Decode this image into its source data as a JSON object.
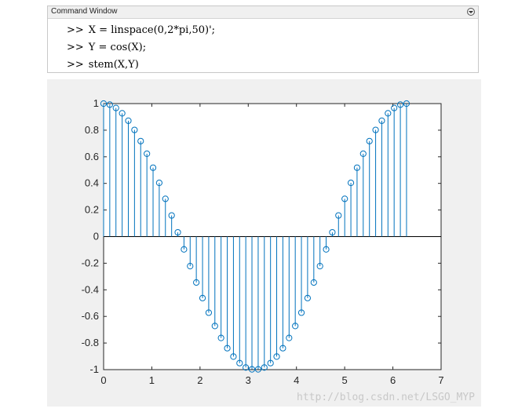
{
  "command_window": {
    "title": "Command Window",
    "prompt": ">>",
    "lines": [
      "X = linspace(0,2*pi,50)';",
      "Y = cos(X);",
      "stem(X,Y)"
    ]
  },
  "colors": {
    "stem": "#0072BD",
    "axes_background": "#ffffff",
    "figure_background": "#f0f0f0"
  },
  "chart_data": {
    "type": "stem",
    "title": "",
    "xlabel": "",
    "ylabel": "",
    "xlim": [
      0,
      7
    ],
    "ylim": [
      -1,
      1
    ],
    "xticks": [
      "0",
      "1",
      "2",
      "3",
      "4",
      "5",
      "6",
      "7"
    ],
    "yticks": [
      "-1",
      "-0.8",
      "-0.6",
      "-0.4",
      "-0.2",
      "0",
      "0.2",
      "0.4",
      "0.6",
      "0.8",
      "1"
    ],
    "grid": false,
    "x": [
      0,
      0.128,
      0.256,
      0.385,
      0.513,
      0.641,
      0.769,
      0.898,
      1.026,
      1.154,
      1.282,
      1.411,
      1.539,
      1.667,
      1.795,
      1.923,
      2.052,
      2.18,
      2.308,
      2.436,
      2.565,
      2.693,
      2.821,
      2.949,
      3.077,
      3.206,
      3.334,
      3.462,
      3.59,
      3.718,
      3.847,
      3.975,
      4.103,
      4.231,
      4.36,
      4.488,
      4.616,
      4.744,
      4.872,
      5.001,
      5.129,
      5.257,
      5.385,
      5.514,
      5.642,
      5.77,
      5.898,
      6.026,
      6.155,
      6.283
    ],
    "y": [
      1.0,
      0.992,
      0.967,
      0.927,
      0.871,
      0.802,
      0.718,
      0.623,
      0.518,
      0.404,
      0.284,
      0.159,
      0.032,
      -0.096,
      -0.222,
      -0.345,
      -0.462,
      -0.572,
      -0.672,
      -0.762,
      -0.839,
      -0.902,
      -0.951,
      -0.984,
      -0.998,
      -0.998,
      -0.984,
      -0.951,
      -0.902,
      -0.839,
      -0.762,
      -0.672,
      -0.572,
      -0.462,
      -0.345,
      -0.222,
      -0.096,
      0.032,
      0.159,
      0.284,
      0.404,
      0.518,
      0.623,
      0.718,
      0.802,
      0.871,
      0.927,
      0.967,
      0.992,
      1.0
    ]
  },
  "watermark": "http://blog.csdn.net/LSGO_MYP"
}
